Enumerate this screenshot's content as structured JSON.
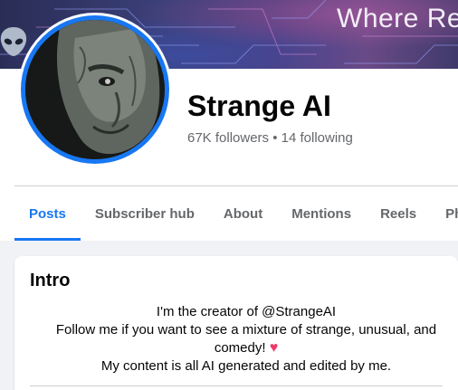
{
  "cover": {
    "text": "Where Re"
  },
  "profile": {
    "name": "Strange AI",
    "stats": "67K followers • 14 following"
  },
  "tabs": [
    {
      "label": "Posts",
      "active": true
    },
    {
      "label": "Subscriber hub",
      "active": false
    },
    {
      "label": "About",
      "active": false
    },
    {
      "label": "Mentions",
      "active": false
    },
    {
      "label": "Reels",
      "active": false
    },
    {
      "label": "Photo",
      "active": false
    }
  ],
  "intro": {
    "title": "Intro",
    "bio_line1": "I'm the creator of @StrangeAI",
    "bio_line2": "Follow me if you want to see a mixture of strange, unusual, and",
    "bio_line3": "comedy!",
    "bio_line4": "My content is all AI generated and edited by me."
  },
  "colors": {
    "accent": "#1877f2",
    "heart": "#f0386b"
  },
  "icons": {
    "cover_icon": "alien-icon",
    "bio_heart": "heart-icon"
  }
}
